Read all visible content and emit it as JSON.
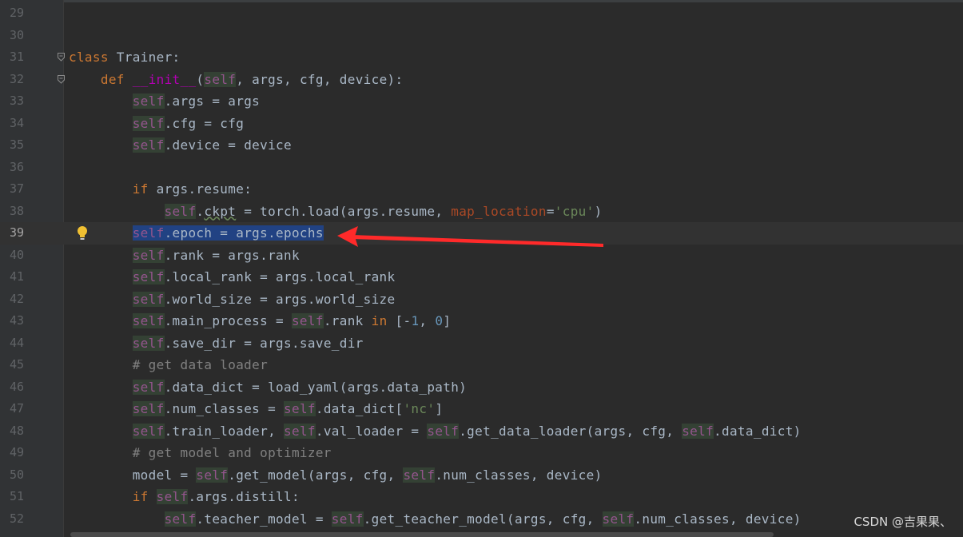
{
  "editor": {
    "current_line": "39",
    "lines": [
      {
        "n": "29",
        "tokens": []
      },
      {
        "n": "30",
        "tokens": []
      },
      {
        "n": "31",
        "fold": true,
        "tokens": [
          [
            "kw",
            "class"
          ],
          [
            "p",
            " Trainer:"
          ]
        ]
      },
      {
        "n": "32",
        "fold": true,
        "tokens": [
          [
            "p",
            "    "
          ],
          [
            "kw",
            "def"
          ],
          [
            "p",
            " "
          ],
          [
            "magic",
            "__init__"
          ],
          [
            "p",
            "("
          ],
          [
            "self",
            "self"
          ],
          [
            "p",
            ", args, cfg, device):"
          ]
        ]
      },
      {
        "n": "33",
        "tokens": [
          [
            "p",
            "        "
          ],
          [
            "self",
            "self"
          ],
          [
            "p",
            ".args = args"
          ]
        ]
      },
      {
        "n": "34",
        "tokens": [
          [
            "p",
            "        "
          ],
          [
            "self",
            "self"
          ],
          [
            "p",
            ".cfg = cfg"
          ]
        ]
      },
      {
        "n": "35",
        "tokens": [
          [
            "p",
            "        "
          ],
          [
            "self",
            "self"
          ],
          [
            "p",
            ".device = device"
          ]
        ]
      },
      {
        "n": "36",
        "tokens": []
      },
      {
        "n": "37",
        "tokens": [
          [
            "p",
            "        "
          ],
          [
            "kw",
            "if"
          ],
          [
            "p",
            " args.resume:"
          ]
        ]
      },
      {
        "n": "38",
        "tokens": [
          [
            "p",
            "            "
          ],
          [
            "self",
            "self"
          ],
          [
            "p",
            "."
          ],
          [
            "weak",
            "ckpt"
          ],
          [
            "p",
            " = torch.load(args.resume, "
          ],
          [
            "param",
            "map_location"
          ],
          [
            "p",
            "="
          ],
          [
            "str",
            "'cpu'"
          ],
          [
            "p",
            ")"
          ]
        ]
      },
      {
        "n": "39",
        "bulb": true,
        "tokens": [
          [
            "p",
            "        "
          ],
          [
            "selself",
            "self"
          ],
          [
            "sel",
            ".epoch = args.epochs"
          ]
        ]
      },
      {
        "n": "40",
        "tokens": [
          [
            "p",
            "        "
          ],
          [
            "self",
            "self"
          ],
          [
            "p",
            ".rank = args.rank"
          ]
        ]
      },
      {
        "n": "41",
        "tokens": [
          [
            "p",
            "        "
          ],
          [
            "self",
            "self"
          ],
          [
            "p",
            ".local_rank = args.local_rank"
          ]
        ]
      },
      {
        "n": "42",
        "tokens": [
          [
            "p",
            "        "
          ],
          [
            "self",
            "self"
          ],
          [
            "p",
            ".world_size = args.world_size"
          ]
        ]
      },
      {
        "n": "43",
        "tokens": [
          [
            "p",
            "        "
          ],
          [
            "self",
            "self"
          ],
          [
            "p",
            ".main_process = "
          ],
          [
            "self",
            "self"
          ],
          [
            "p",
            ".rank "
          ],
          [
            "kw",
            "in"
          ],
          [
            "p",
            " [-"
          ],
          [
            "num",
            "1"
          ],
          [
            "p",
            ", "
          ],
          [
            "num",
            "0"
          ],
          [
            "p",
            "]"
          ]
        ]
      },
      {
        "n": "44",
        "tokens": [
          [
            "p",
            "        "
          ],
          [
            "self",
            "self"
          ],
          [
            "p",
            ".save_dir = args.save_dir"
          ]
        ]
      },
      {
        "n": "45",
        "tokens": [
          [
            "p",
            "        "
          ],
          [
            "cmt",
            "# get data loader"
          ]
        ]
      },
      {
        "n": "46",
        "tokens": [
          [
            "p",
            "        "
          ],
          [
            "self",
            "self"
          ],
          [
            "p",
            ".data_dict = load_yaml(args.data_path)"
          ]
        ]
      },
      {
        "n": "47",
        "tokens": [
          [
            "p",
            "        "
          ],
          [
            "self",
            "self"
          ],
          [
            "p",
            ".num_classes = "
          ],
          [
            "self",
            "self"
          ],
          [
            "p",
            ".data_dict["
          ],
          [
            "str",
            "'nc'"
          ],
          [
            "p",
            "]"
          ]
        ]
      },
      {
        "n": "48",
        "tokens": [
          [
            "p",
            "        "
          ],
          [
            "self",
            "self"
          ],
          [
            "p",
            ".train_loader, "
          ],
          [
            "self",
            "self"
          ],
          [
            "p",
            ".val_loader = "
          ],
          [
            "self",
            "self"
          ],
          [
            "p",
            ".get_data_loader(args, cfg, "
          ],
          [
            "self",
            "self"
          ],
          [
            "p",
            ".data_dict)"
          ]
        ]
      },
      {
        "n": "49",
        "tokens": [
          [
            "p",
            "        "
          ],
          [
            "cmt",
            "# get model and optimizer"
          ]
        ]
      },
      {
        "n": "50",
        "tokens": [
          [
            "p",
            "        model = "
          ],
          [
            "self",
            "self"
          ],
          [
            "p",
            ".get_model(args, cfg, "
          ],
          [
            "self",
            "self"
          ],
          [
            "p",
            ".num_classes, device)"
          ]
        ]
      },
      {
        "n": "51",
        "tokens": [
          [
            "p",
            "        "
          ],
          [
            "kw",
            "if"
          ],
          [
            "p",
            " "
          ],
          [
            "self",
            "self"
          ],
          [
            "p",
            ".args.distill:"
          ]
        ]
      },
      {
        "n": "52",
        "tokens": [
          [
            "p",
            "            "
          ],
          [
            "self",
            "self"
          ],
          [
            "p",
            ".teacher_model = "
          ],
          [
            "self",
            "self"
          ],
          [
            "p",
            ".get_teacher_model(args, cfg, "
          ],
          [
            "self",
            "self"
          ],
          [
            "p",
            ".num_classes, device)"
          ]
        ]
      }
    ]
  },
  "icons": {
    "fold": "fold-marker-icon",
    "bulb": "lightbulb-icon",
    "arrow": "red-arrow-annotation"
  },
  "colors": {
    "background": "#2b2b2b",
    "gutter": "#313335",
    "keyword": "#cc7832",
    "self": "#94558d",
    "string": "#6a8759",
    "number": "#6897bb",
    "comment": "#808080",
    "selection": "#214283",
    "arrow": "#ff2a2a"
  },
  "watermark": "CSDN @吉果果、"
}
